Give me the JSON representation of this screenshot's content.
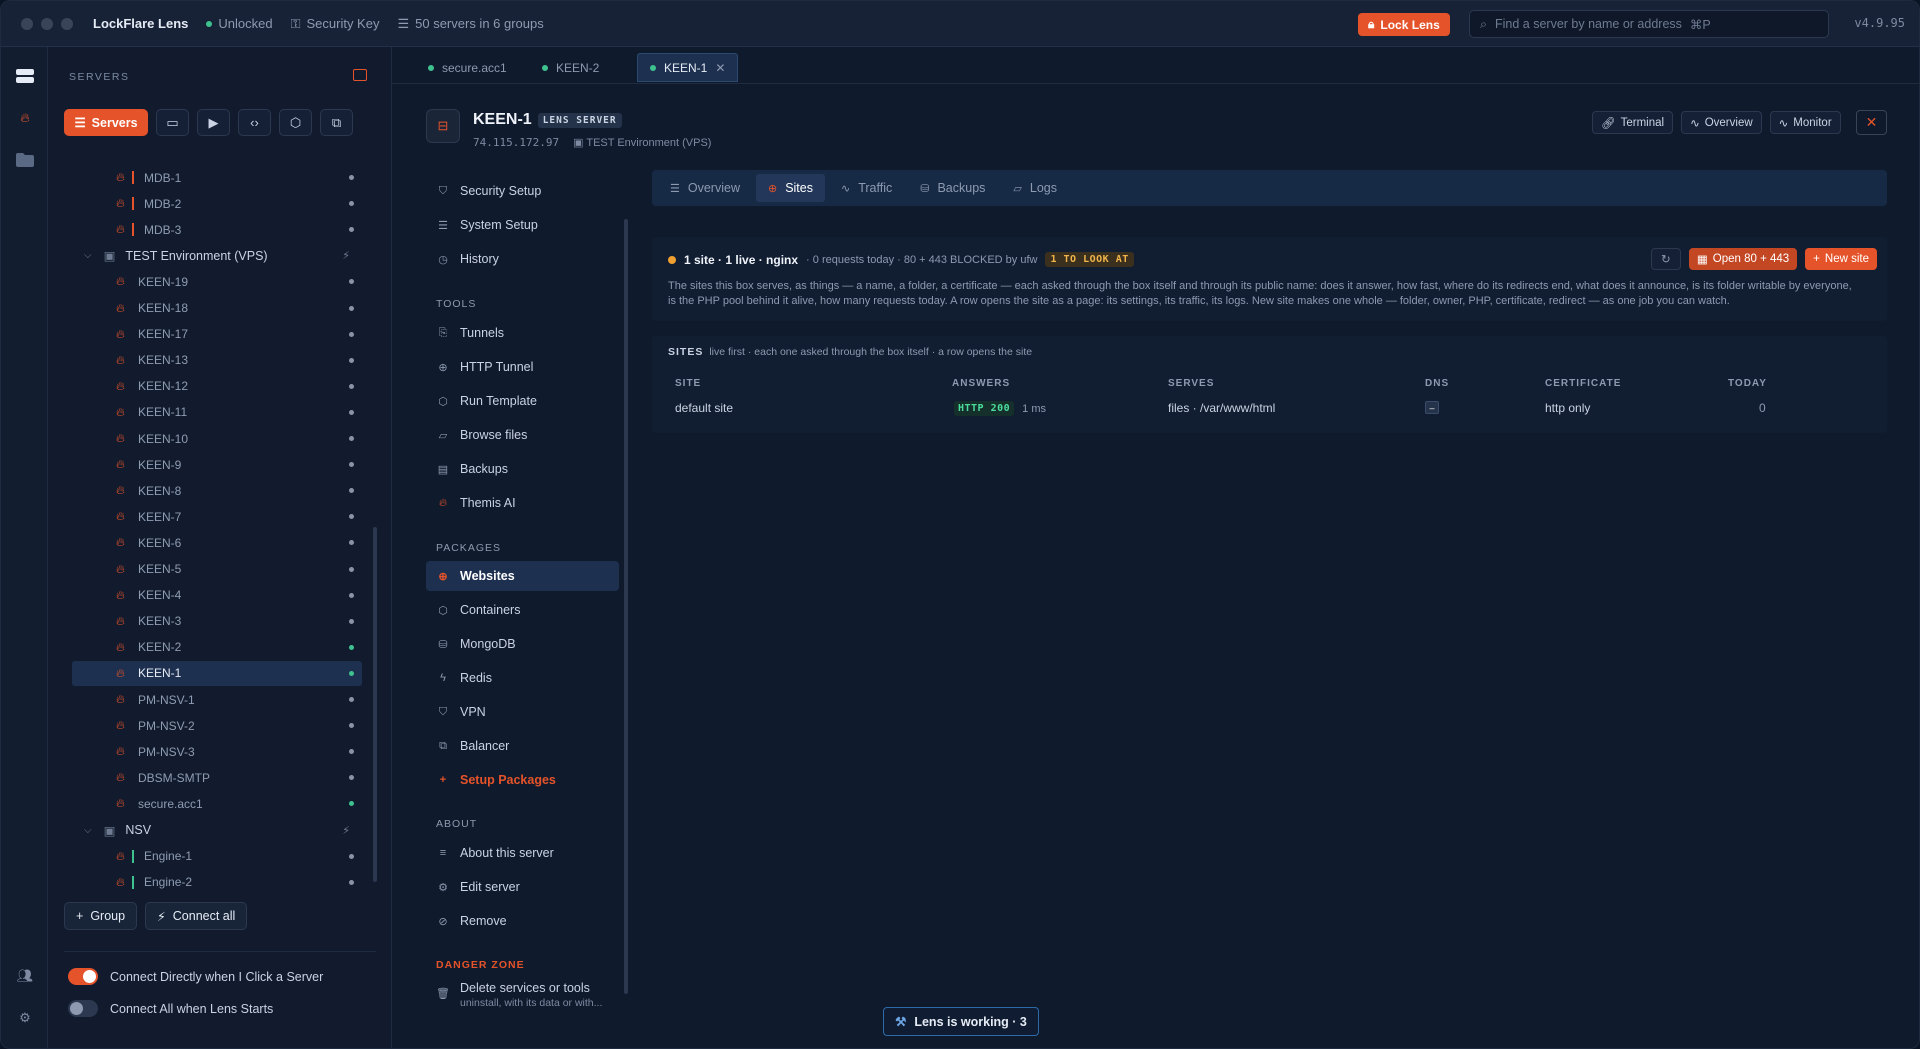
{
  "app": {
    "title": "LockFlare Lens",
    "status": "Unlocked",
    "security_key": "Security Key",
    "servers_summary": "50 servers in 6 groups",
    "lock_label": "Lock Lens",
    "search_placeholder": "Find a server by name or address",
    "search_shortcut": "⌘P",
    "version": "v4.9.95"
  },
  "sidebar": {
    "heading": "SERVERS",
    "servers_tab": "Servers",
    "tree": [
      {
        "type": "server",
        "name": "MDB-1",
        "bar": "red",
        "status": "off"
      },
      {
        "type": "server",
        "name": "MDB-2",
        "bar": "red",
        "status": "off"
      },
      {
        "type": "server",
        "name": "MDB-3",
        "bar": "red",
        "status": "off"
      },
      {
        "type": "group",
        "name": "TEST Environment (VPS)"
      },
      {
        "type": "server",
        "name": "KEEN-19",
        "status": "off"
      },
      {
        "type": "server",
        "name": "KEEN-18",
        "status": "off"
      },
      {
        "type": "server",
        "name": "KEEN-17",
        "status": "off"
      },
      {
        "type": "server",
        "name": "KEEN-13",
        "status": "off"
      },
      {
        "type": "server",
        "name": "KEEN-12",
        "status": "off"
      },
      {
        "type": "server",
        "name": "KEEN-11",
        "status": "off"
      },
      {
        "type": "server",
        "name": "KEEN-10",
        "status": "off"
      },
      {
        "type": "server",
        "name": "KEEN-9",
        "status": "off"
      },
      {
        "type": "server",
        "name": "KEEN-8",
        "status": "off"
      },
      {
        "type": "server",
        "name": "KEEN-7",
        "status": "off"
      },
      {
        "type": "server",
        "name": "KEEN-6",
        "status": "off"
      },
      {
        "type": "server",
        "name": "KEEN-5",
        "status": "off"
      },
      {
        "type": "server",
        "name": "KEEN-4",
        "status": "off"
      },
      {
        "type": "server",
        "name": "KEEN-3",
        "status": "off"
      },
      {
        "type": "server",
        "name": "KEEN-2",
        "status": "on"
      },
      {
        "type": "server",
        "name": "KEEN-1",
        "status": "on",
        "selected": true
      },
      {
        "type": "server",
        "name": "PM-NSV-1",
        "status": "off"
      },
      {
        "type": "server",
        "name": "PM-NSV-2",
        "status": "off"
      },
      {
        "type": "server",
        "name": "PM-NSV-3",
        "status": "off"
      },
      {
        "type": "server",
        "name": "DBSM-SMTP",
        "status": "off"
      },
      {
        "type": "server",
        "name": "secure.acc1",
        "status": "on"
      },
      {
        "type": "group",
        "name": "NSV"
      },
      {
        "type": "server",
        "name": "Engine-1",
        "bar": "green",
        "status": "off"
      },
      {
        "type": "server",
        "name": "Engine-2",
        "bar": "green",
        "status": "off"
      }
    ],
    "group_btn": "Group",
    "connect_all_btn": "Connect all",
    "toggle1": "Connect Directly when I Click a Server",
    "toggle2": "Connect All when Lens Starts"
  },
  "tabs": [
    {
      "label": "secure.acc1"
    },
    {
      "label": "KEEN-2"
    },
    {
      "label": "KEEN-1",
      "close": "✕"
    }
  ],
  "header": {
    "title": "KEEN-1",
    "badge": "LENS SERVER",
    "ip": "74.115.172.97",
    "env": "TEST Environment (VPS)",
    "btn_terminal": "Terminal",
    "btn_overview": "Overview",
    "btn_monitor": "Monitor"
  },
  "nav": {
    "items_top": [
      "Security Setup",
      "System Setup",
      "History"
    ],
    "tools_heading": "TOOLS",
    "tools": [
      "Tunnels",
      "HTTP Tunnel",
      "Run Template",
      "Browse files",
      "Backups",
      "Themis AI"
    ],
    "packages_heading": "PACKAGES",
    "packages": [
      "Websites",
      "Containers",
      "MongoDB",
      "Redis",
      "VPN",
      "Balancer",
      "Setup Packages"
    ],
    "about_heading": "ABOUT",
    "about": [
      "About this server",
      "Edit server",
      "Remove"
    ],
    "danger_heading": "DANGER ZONE",
    "danger_title": "Delete services or tools",
    "danger_sub": "uninstall, with its data or with..."
  },
  "content_tabs": [
    "Overview",
    "Sites",
    "Traffic",
    "Backups",
    "Logs"
  ],
  "summary": {
    "main": "1 site · 1 live · nginx",
    "meta": "· 0 requests today · 80 + 443 BLOCKED by ufw",
    "badge": "1 TO LOOK AT",
    "desc": "The sites this box serves, as things — a name, a folder, a certificate — each asked through the box itself and through its public name: does it answer, how fast, where do its redirects end, what does it announce, is its folder writable by everyone, is the PHP pool behind it alive, how many requests today. A row opens the site as a page: its settings, its traffic, its logs. New site makes one whole — folder, owner, PHP, certificate, redirect — as one job you can watch.",
    "open_btn": "Open 80 + 443",
    "new_btn": "New site"
  },
  "sites": {
    "heading": "SITES",
    "subheading": "live first · each one asked through the box itself · a row opens the site",
    "columns": [
      "SITE",
      "ANSWERS",
      "SERVES",
      "DNS",
      "CERTIFICATE",
      "TODAY"
    ],
    "row": {
      "site": "default site",
      "http": "HTTP 200",
      "ms": "1 ms",
      "serves": "files · /var/www/html",
      "dns": "–",
      "cert": "http only",
      "today": "0"
    }
  },
  "working": "Lens is working · 3",
  "colors": {
    "accent": "#e5532a",
    "live": "#3ec28f",
    "bg": "#0f1a2c"
  }
}
